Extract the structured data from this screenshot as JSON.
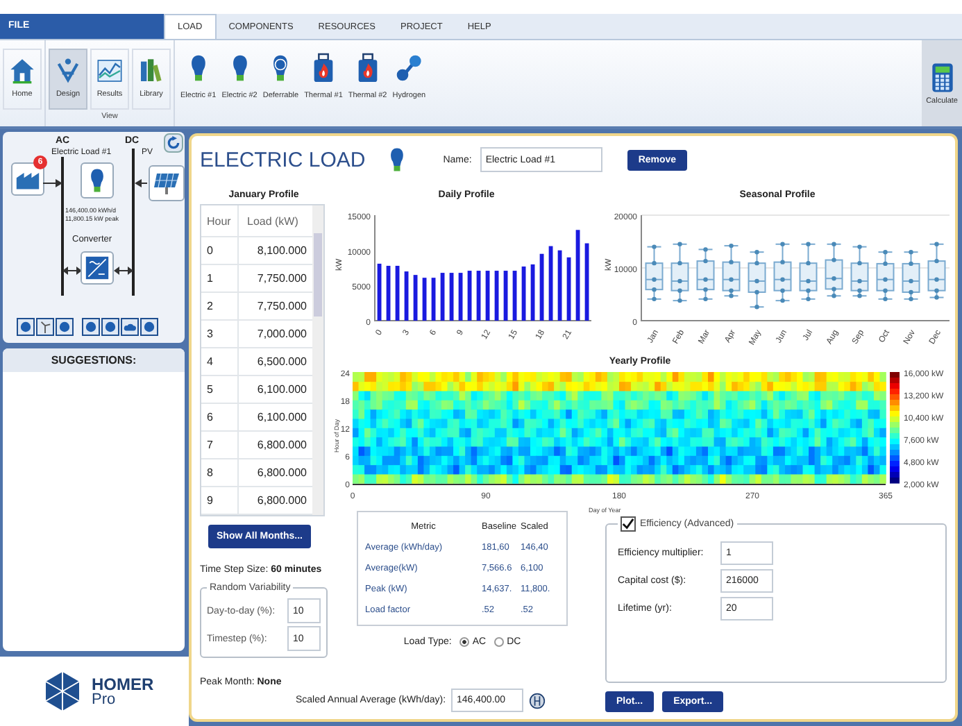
{
  "menu": {
    "file": "FILE",
    "tabs": [
      {
        "label": "LOAD",
        "selected": true
      },
      {
        "label": "COMPONENTS",
        "selected": false
      },
      {
        "label": "RESOURCES",
        "selected": false
      },
      {
        "label": "PROJECT",
        "selected": false
      },
      {
        "label": "HELP",
        "selected": false
      }
    ]
  },
  "ribbon": {
    "home": {
      "label": "Home",
      "kind": "home"
    },
    "view_group": "View",
    "view_buttons": [
      {
        "label": "Design",
        "kind": "design",
        "selected": true
      },
      {
        "label": "Results",
        "kind": "results",
        "selected": false
      },
      {
        "label": "Library",
        "kind": "library",
        "selected": false
      }
    ],
    "load_buttons": [
      {
        "label": "Electric #1",
        "kind": "bulb"
      },
      {
        "label": "Electric #2",
        "kind": "bulb"
      },
      {
        "label": "Deferrable",
        "kind": "deferrable"
      },
      {
        "label": "Thermal #1",
        "kind": "thermal"
      },
      {
        "label": "Thermal #2",
        "kind": "thermal"
      },
      {
        "label": "Hydrogen",
        "kind": "hydrogen"
      }
    ],
    "calculate": "Calculate"
  },
  "schematic": {
    "ac": "AC",
    "dc": "DC",
    "load_name": "Electric Load #1",
    "load_energy": "146,400.00 kWh/d",
    "load_peak": "11,800.15 kW peak",
    "converter": "Converter",
    "pv": "PV",
    "badge": "6"
  },
  "suggestions": {
    "title": "SUGGESTIONS:"
  },
  "logo": {
    "name": "HOMER",
    "sub": "Pro"
  },
  "editor": {
    "title": "ELECTRIC LOAD",
    "name_label": "Name:",
    "name_value": "Electric Load #1",
    "remove": "Remove",
    "profile": {
      "title": "January Profile",
      "columns": [
        "Hour",
        "Load (kW)"
      ],
      "rows": [
        [
          "0",
          "8,100.000"
        ],
        [
          "1",
          "7,750.000"
        ],
        [
          "2",
          "7,750.000"
        ],
        [
          "3",
          "7,000.000"
        ],
        [
          "4",
          "6,500.000"
        ],
        [
          "5",
          "6,100.000"
        ],
        [
          "6",
          "6,100.000"
        ],
        [
          "7",
          "6,800.000"
        ],
        [
          "8",
          "6,800.000"
        ],
        [
          "9",
          "6,800.000"
        ]
      ]
    },
    "show_all": "Show All Months...",
    "time_step": "Time Step Size: **60 minutes**",
    "variability": {
      "title": "Random Variability",
      "fields": [
        {
          "label": "Day-to-day (%):",
          "value": "10"
        },
        {
          "label": "Timestep (%):",
          "value": "10"
        }
      ]
    },
    "peak_month": "Peak Month: **None**",
    "daily": {
      "chart_data": {
        "type": "bar",
        "title": "Daily Profile",
        "ylabel": "kW",
        "x": [
          0,
          1,
          2,
          3,
          4,
          5,
          6,
          7,
          8,
          9,
          10,
          11,
          12,
          13,
          14,
          15,
          16,
          17,
          18,
          19,
          20,
          21,
          22,
          23
        ],
        "values": [
          8100,
          7800,
          7800,
          7000,
          6500,
          6100,
          6100,
          6800,
          6800,
          6800,
          7100,
          7100,
          7100,
          7100,
          7100,
          7100,
          7700,
          8000,
          9500,
          10600,
          10000,
          9000,
          12900,
          11000
        ],
        "xlim": [
          -0.5,
          23.5
        ],
        "ylim": [
          0,
          15000
        ],
        "yticks": [
          0,
          5000,
          10000,
          15000
        ],
        "xticks": [
          0,
          3,
          6,
          9,
          12,
          15,
          18,
          21
        ]
      }
    },
    "seasonal": {
      "chart_data": {
        "type": "scatter",
        "title": "Seasonal Profile",
        "ylabel": "kW",
        "categories": [
          "Jan",
          "Feb",
          "Mar",
          "Apr",
          "May",
          "Jun",
          "Jul",
          "Aug",
          "Sep",
          "Oct",
          "Nov",
          "Dec"
        ],
        "ylim": [
          0,
          20000
        ],
        "yticks": [
          0,
          10000,
          20000
        ],
        "series": [
          {
            "color": "#4a8ab8",
            "values": [
              14000,
              14500,
              13500,
              14200,
              13000,
              14500,
              14500,
              14500,
              14000,
              13000,
              13000,
              14500
            ]
          },
          {
            "color": "#4a8ab8",
            "values": [
              10900,
              10900,
              11300,
              11100,
              10900,
              11100,
              10900,
              11500,
              10900,
              10800,
              10800,
              11300
            ]
          },
          {
            "color": "#4a8ab8",
            "values": [
              7800,
              7500,
              7800,
              7800,
              7500,
              7800,
              7500,
              8000,
              7500,
              7800,
              7500,
              7800
            ]
          },
          {
            "color": "#4a8ab8",
            "values": [
              5900,
              5700,
              5900,
              5700,
              5400,
              5700,
              5700,
              6000,
              5700,
              5700,
              5400,
              5700
            ]
          },
          {
            "color": "#4a8ab8",
            "values": [
              4100,
              3800,
              4100,
              4700,
              2600,
              3800,
              4100,
              4700,
              4700,
              4100,
              4100,
              4400
            ]
          }
        ]
      }
    },
    "yearly": {
      "title": "Yearly Profile",
      "xlabel": "Day of Year",
      "ylabel": "Hour of Day",
      "xticks": [
        "0",
        "90",
        "180",
        "270",
        "365"
      ],
      "yticks": [
        "24",
        "18",
        "12",
        "6",
        "0"
      ],
      "scale": [
        "16,000 kW",
        "13,200 kW",
        "10,400 kW",
        "7,600 kW",
        "4,800 kW",
        "2,000 kW"
      ]
    },
    "metrics": {
      "columns": [
        "Metric",
        "Baseline",
        "Scaled"
      ],
      "rows": [
        [
          "Average (kWh/day)",
          "181,60",
          "146,40"
        ],
        [
          "Average(kW)",
          "7,566.6",
          "6,100"
        ],
        [
          "Peak (kW)",
          "14,637.",
          "11,800."
        ],
        [
          "Load factor",
          ".52",
          ".52"
        ]
      ]
    },
    "load_type": {
      "label": "Load Type:",
      "options": [
        {
          "label": "AC",
          "selected": true
        },
        {
          "label": "DC",
          "selected": false
        }
      ]
    },
    "scaled": {
      "label": "Scaled Annual Average (kWh/day):",
      "value": "146,400.00"
    },
    "efficiency": {
      "label": "Efficiency (Advanced)",
      "checked": true,
      "fields": [
        {
          "label": "Efficiency multiplier:",
          "value": "1"
        },
        {
          "label": "Capital cost ($):",
          "value": "216000"
        },
        {
          "label": "Lifetime (yr):",
          "value": "20"
        }
      ]
    },
    "buttons": [
      "Plot...",
      "Export..."
    ]
  }
}
